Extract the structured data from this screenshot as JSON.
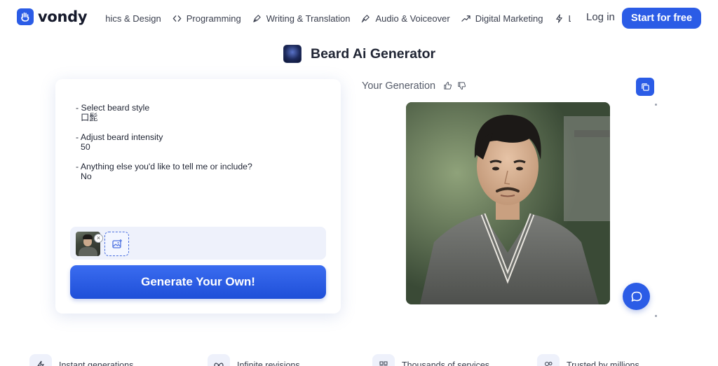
{
  "brand": {
    "name": "vondy"
  },
  "nav": {
    "items": [
      {
        "label": "phics & Design",
        "icon": "palette-icon"
      },
      {
        "label": "Programming",
        "icon": "code-icon"
      },
      {
        "label": "Writing & Translation",
        "icon": "pen-nib-icon"
      },
      {
        "label": "Audio & Voiceover",
        "icon": "microphone-icon"
      },
      {
        "label": "Digital Marketing",
        "icon": "trend-up-icon"
      },
      {
        "label": "L",
        "icon": "bolt-icon"
      }
    ],
    "login": "Log in",
    "cta": "Start for free"
  },
  "page": {
    "title": "Beard Ai Generator"
  },
  "form": {
    "prompts": [
      {
        "label": "- Select beard style",
        "value": "口髭"
      },
      {
        "label": "- Adjust beard intensity",
        "value": "50"
      },
      {
        "label": "- Anything else you'd like to tell me or include?",
        "value": "No"
      }
    ],
    "remove_glyph": "×",
    "generate_label": "Generate Your Own!"
  },
  "result": {
    "label": "Your Generation"
  },
  "features": [
    {
      "label": "Instant generations",
      "icon": "bolt-icon"
    },
    {
      "label": "Infinite revisions",
      "icon": "infinity-icon"
    },
    {
      "label": "Thousands of services",
      "icon": "grid-icon"
    },
    {
      "label": "Trusted by millions",
      "icon": "users-icon"
    }
  ],
  "colors": {
    "accent": "#2b5ce6",
    "text": "#1f2433",
    "muted": "#555b69",
    "panel": "#eef1fb"
  }
}
